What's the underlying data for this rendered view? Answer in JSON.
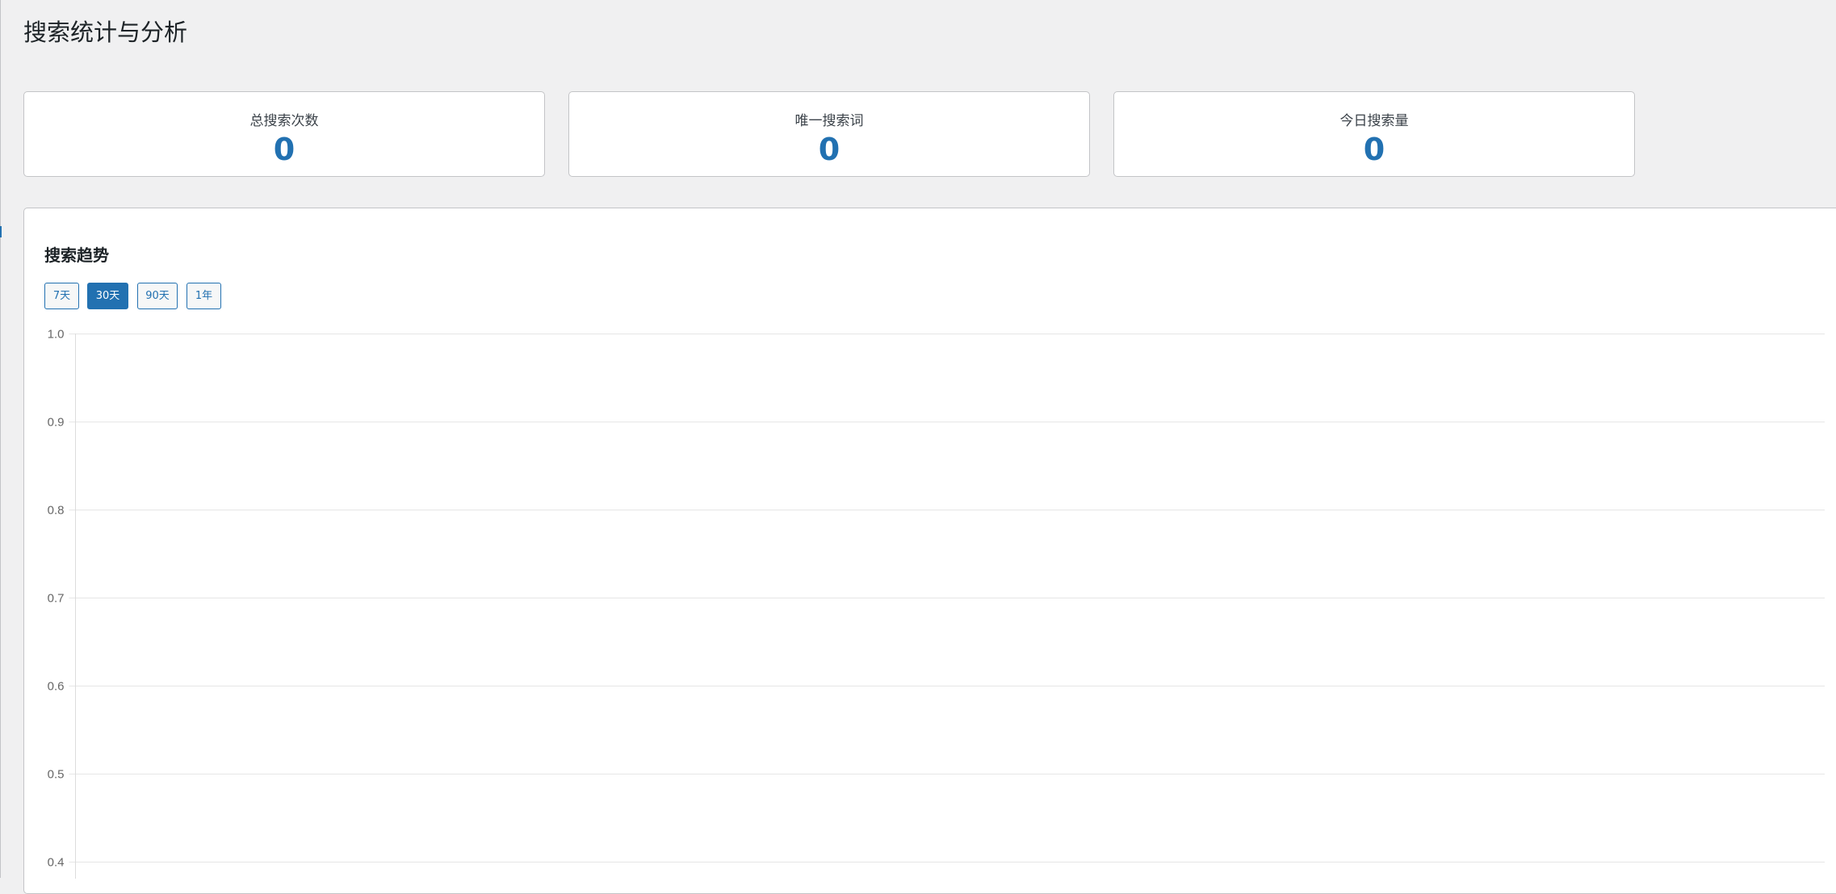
{
  "page": {
    "title": "搜索统计与分析"
  },
  "stats": [
    {
      "label": "总搜索次数",
      "value": "0"
    },
    {
      "label": "唯一搜索词",
      "value": "0"
    },
    {
      "label": "今日搜索量",
      "value": "0"
    }
  ],
  "trend": {
    "title": "搜索趋势",
    "ranges": [
      {
        "label": "7天",
        "active": false
      },
      {
        "label": "30天",
        "active": true
      },
      {
        "label": "90天",
        "active": false
      },
      {
        "label": "1年",
        "active": false
      }
    ]
  },
  "colors": {
    "accent": "#2271b1",
    "background": "#f0f0f1",
    "card": "#ffffff",
    "border": "#c3c4c7",
    "grid": "#e6e6e6"
  },
  "chart_data": {
    "type": "line",
    "title": "",
    "xlabel": "",
    "ylabel": "",
    "x": [],
    "series": [],
    "ylim": [
      0.4,
      1.0
    ],
    "yticks": [
      "1.0",
      "0.9",
      "0.8",
      "0.7",
      "0.6",
      "0.5",
      "0.4"
    ],
    "grid": true
  }
}
